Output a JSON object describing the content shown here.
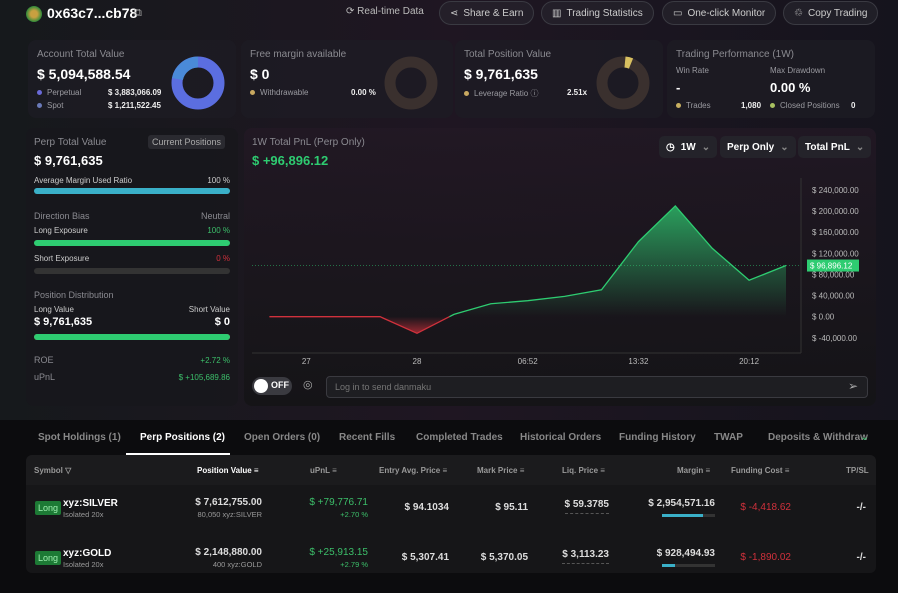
{
  "header": {
    "address": "0x63c7...cb78",
    "buttons": [
      "Real-time Data",
      "Share & Earn",
      "Trading Statistics",
      "One-click Monitor",
      "Copy Trading"
    ]
  },
  "cards": {
    "account": {
      "title": "Account Total Value",
      "value": "$ 5,094,588.54",
      "rows": [
        {
          "label": "Perpetual",
          "value": "$ 3,883,066.09"
        },
        {
          "label": "Spot",
          "value": "$ 1,211,522.45"
        }
      ]
    },
    "margin": {
      "title": "Free margin available",
      "value": "$ 0",
      "label": "Withdrawable",
      "pct": "0.00 %"
    },
    "position": {
      "title": "Total Position Value",
      "value": "$ 9,761,635",
      "label": "Leverage Ratio",
      "lev": "2.51x"
    },
    "perf": {
      "title": "Trading Performance (1W)",
      "win_label": "Win Rate",
      "win": "-",
      "dd_label": "Max Drawdown",
      "dd": "0.00 %",
      "trades_label": "Trades",
      "trades": "1,080",
      "closed_label": "Closed Positions",
      "closed": "0"
    }
  },
  "left": {
    "title": "Perp Total Value",
    "badge": "Current Positions",
    "value": "$ 9,761,635",
    "amu_label": "Average Margin Used Ratio",
    "amu": "100 %",
    "amu_frac": 1.0,
    "bias_label": "Direction Bias",
    "bias": "Neutral",
    "long_label": "Long Exposure",
    "long": "100 %",
    "long_frac": 1.0,
    "short_label": "Short Exposure",
    "short": "0 %",
    "short_frac": 0,
    "dist_label": "Position Distribution",
    "lv_label": "Long Value",
    "sv_label": "Short Value",
    "lv": "$ 9,761,635",
    "sv": "$ 0",
    "dist_frac": 1.0,
    "roe_label": "ROE",
    "roe": "+2.72 %",
    "upnl_label": "uPnL",
    "upnl": "$ +105,689.86"
  },
  "chart_panel": {
    "title": "1W Total PnL (Perp Only)",
    "value": "$ +96,896.12",
    "selects": [
      "1W",
      "Perp Only",
      "Total PnL"
    ],
    "toggle": "OFF",
    "placeholder": "Log in to send danmaku"
  },
  "chart_data": {
    "type": "area",
    "title": "1W Total PnL (Perp Only)",
    "x": [
      0,
      3,
      4,
      5,
      6,
      7,
      8,
      9,
      10,
      11,
      12,
      13,
      14
    ],
    "values": [
      0,
      0,
      -31500,
      4400,
      24600,
      30300,
      38500,
      51100,
      142000,
      209800,
      129600,
      69000,
      96896.12
    ],
    "x_ticks": [
      {
        "x": 1,
        "label": "27"
      },
      {
        "x": 4,
        "label": "28"
      },
      {
        "x": 7,
        "label": "06:52"
      },
      {
        "x": 10,
        "label": "13:32"
      },
      {
        "x": 13,
        "label": "20:12"
      }
    ],
    "y_ticks": [
      {
        "v": 240000,
        "label": "$ 240,000.00"
      },
      {
        "v": 200000,
        "label": "$ 200,000.00"
      },
      {
        "v": 160000,
        "label": "$ 160,000.00"
      },
      {
        "v": 120000,
        "label": "$ 120,000.00"
      },
      {
        "v": 80000,
        "label": "$ 80,000.00"
      },
      {
        "v": 40000,
        "label": "$ 40,000.00"
      },
      {
        "v": 0,
        "label": "$ 0.00"
      },
      {
        "v": -40000,
        "label": "$ -40,000.00"
      }
    ],
    "current": {
      "v": 96896.12,
      "label": "$ 96,896.12"
    },
    "ylim": [
      -60000,
      260000
    ],
    "colors": {
      "up": "#2ecc71",
      "down": "#d0313c"
    }
  },
  "tabs": [
    "Spot Holdings (1)",
    "Perp Positions (2)",
    "Open Orders (0)",
    "Recent Fills",
    "Completed Trades",
    "Historical Orders",
    "Funding History",
    "TWAP",
    "Deposits & Withdraw"
  ],
  "table": {
    "headers": [
      "Symbol",
      "Position Value",
      "uPnL",
      "Entry Avg. Price",
      "Mark Price",
      "Liq. Price",
      "Margin",
      "Funding Cost",
      "TP/SL"
    ],
    "rows": [
      {
        "side": "Long",
        "symbol": "xyz:SILVER",
        "mode": "Isolated 20x",
        "value": "$ 7,612,755.00",
        "size": "80,050 xyz:SILVER",
        "upnl": "$ +79,776.71",
        "upnl_pct": "+2.70 %",
        "entry": "$ 94.1034",
        "mark": "$ 95.11",
        "liq": "$ 59.3785",
        "margin": "$ 2,954,571.16",
        "margin_frac": 0.78,
        "funding": "$ -4,418.62",
        "tpsl": "-/-"
      },
      {
        "side": "Long",
        "symbol": "xyz:GOLD",
        "mode": "Isolated 20x",
        "value": "$ 2,148,880.00",
        "size": "400 xyz:GOLD",
        "upnl": "$ +25,913.15",
        "upnl_pct": "+2.79 %",
        "entry": "$ 5,307.41",
        "mark": "$ 5,370.05",
        "liq": "$ 3,113.23",
        "margin": "$ 928,494.93",
        "margin_frac": 0.25,
        "funding": "$ -1,890.02",
        "tpsl": "-/-"
      }
    ]
  }
}
